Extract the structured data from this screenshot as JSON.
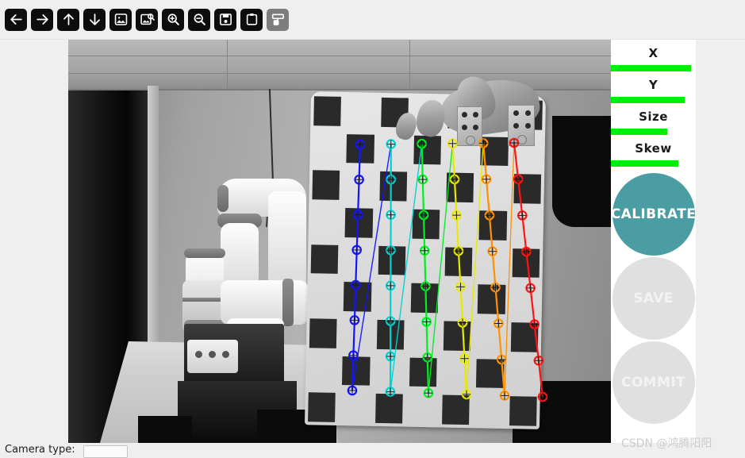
{
  "toolbar": {
    "buttons": [
      {
        "name": "back-arrow-icon",
        "label": "Back",
        "icon": "arrow-left",
        "state": "enabled"
      },
      {
        "name": "forward-arrow-icon",
        "label": "Forward",
        "icon": "arrow-right",
        "state": "enabled"
      },
      {
        "name": "up-arrow-icon",
        "label": "Up",
        "icon": "arrow-up",
        "state": "enabled"
      },
      {
        "name": "down-arrow-icon",
        "label": "Down",
        "icon": "arrow-down",
        "state": "enabled"
      },
      {
        "name": "image-icon",
        "label": "Image",
        "icon": "image",
        "state": "enabled"
      },
      {
        "name": "image-search-icon",
        "label": "Inspect Image",
        "icon": "image-search",
        "state": "enabled"
      },
      {
        "name": "zoom-in-icon",
        "label": "Zoom In",
        "icon": "zoom-in",
        "state": "enabled"
      },
      {
        "name": "zoom-out-icon",
        "label": "Zoom Out",
        "icon": "zoom-out",
        "state": "enabled"
      },
      {
        "name": "save-icon",
        "label": "Save",
        "icon": "floppy-disk",
        "state": "enabled"
      },
      {
        "name": "clipboard-icon",
        "label": "Clipboard",
        "icon": "clipboard",
        "state": "enabled"
      },
      {
        "name": "paint-icon",
        "label": "Paint",
        "icon": "paint-roller",
        "state": "disabled"
      }
    ]
  },
  "side_panel": {
    "metrics": [
      {
        "label": "X",
        "value_pct": 94,
        "color": "#00ee00"
      },
      {
        "label": "Y",
        "value_pct": 87,
        "color": "#00ee00"
      },
      {
        "label": "Size",
        "value_pct": 66,
        "color": "#00ee00"
      },
      {
        "label": "Skew",
        "value_pct": 79,
        "color": "#00ee00"
      }
    ],
    "buttons": [
      {
        "label": "CALIBRATE",
        "state": "active",
        "color": "#4a9da3"
      },
      {
        "label": "SAVE",
        "state": "disabled",
        "color": "#e0e0e0"
      },
      {
        "label": "COMMIT",
        "state": "disabled",
        "color": "#e0e0e0"
      }
    ]
  },
  "footer": {
    "camera_type_label": "Camera type:",
    "camera_type_value": ""
  },
  "watermark": {
    "text": "CSDN @鸿腾阳阳"
  },
  "viewport": {
    "scene_description": "Grayscale camera feed: white collaborative robot arm on a bench beside a doorway, a hand holding a checkerboard calibration target toward the camera.",
    "calibration_overlay": {
      "pattern_columns": 6,
      "pattern_rows": 8,
      "column_colors": [
        "#1414ff",
        "#00d2d2",
        "#00ee22",
        "#e8e800",
        "#ff9100",
        "#ff1414"
      ]
    }
  }
}
